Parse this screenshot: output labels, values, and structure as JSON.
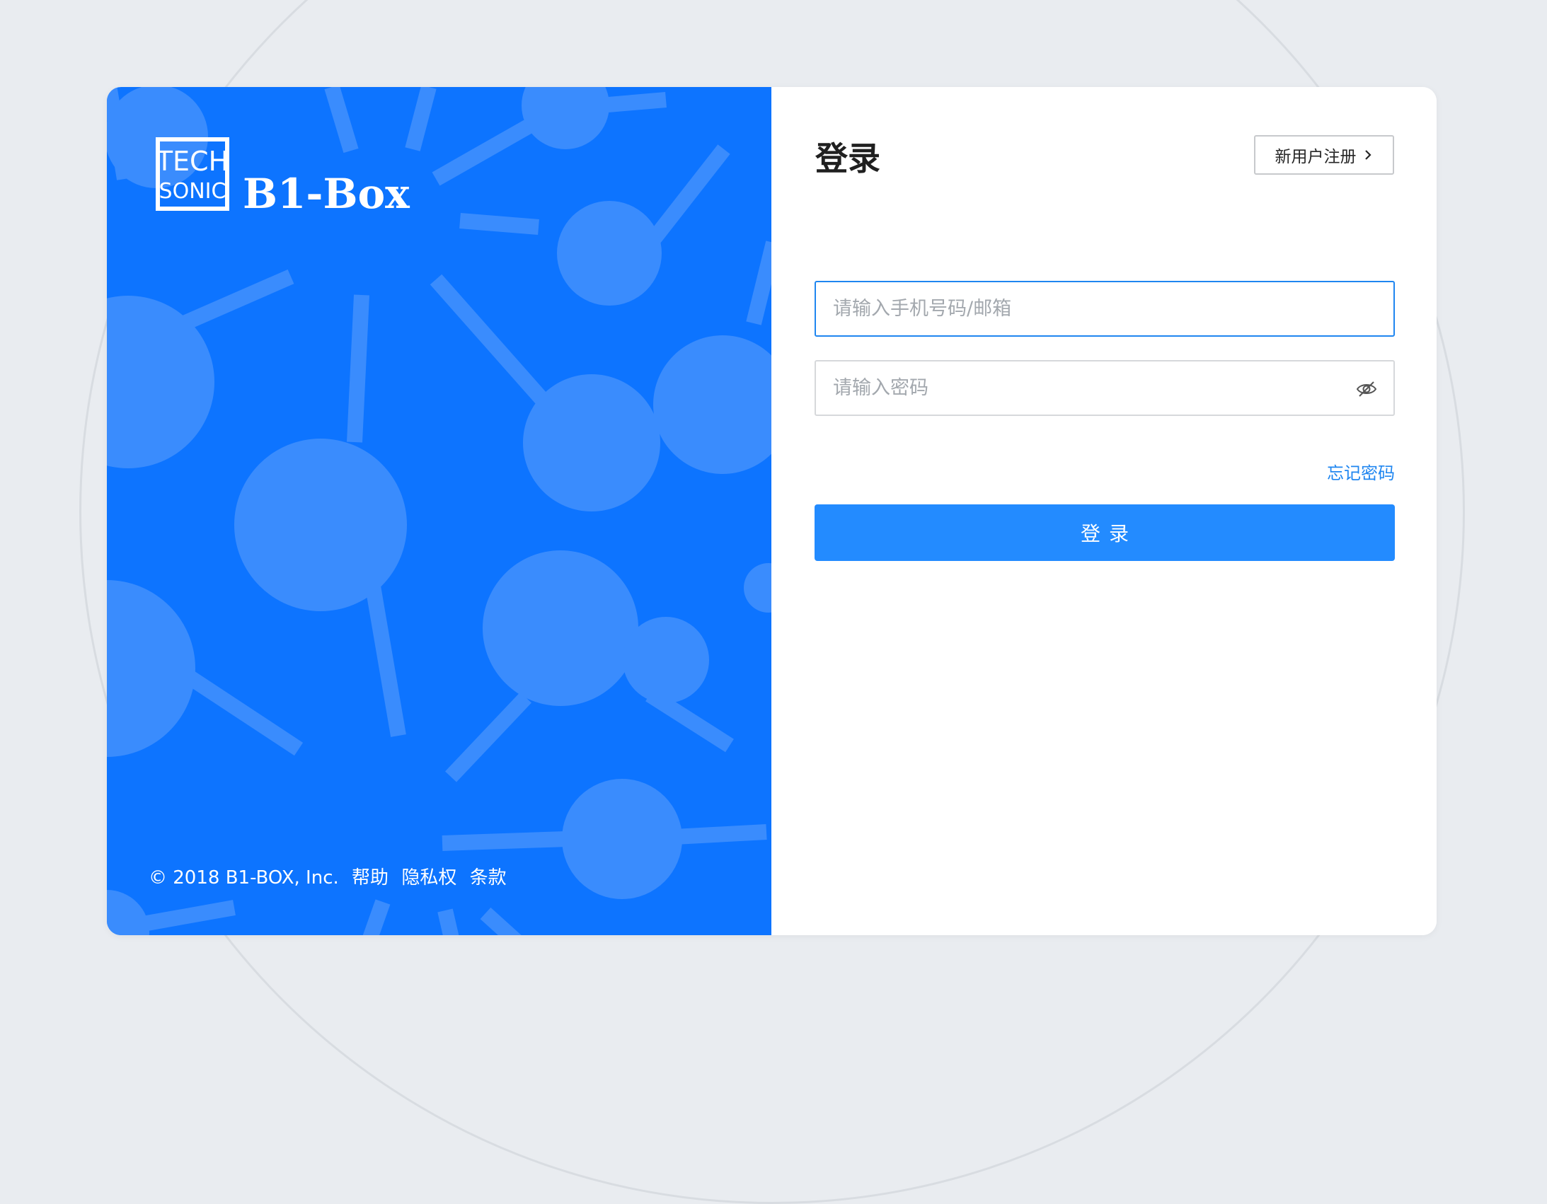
{
  "brand": {
    "logo_line1": "TECH",
    "logo_line2": "SONIC",
    "product_name": "B1-Box"
  },
  "footer": {
    "copyright": "© 2018 B1-BOX, Inc.",
    "links": [
      {
        "label": "帮助"
      },
      {
        "label": "隐私权"
      },
      {
        "label": "条款"
      }
    ]
  },
  "login": {
    "title": "登录",
    "register_label": "新用户注册",
    "account_placeholder": "请输入手机号码/邮箱",
    "password_placeholder": "请输入密码",
    "forgot_label": "忘记密码",
    "submit_label": "登录"
  },
  "icons": {
    "register_arrow": "chevron-right-icon",
    "password_toggle": "eye-off-icon"
  },
  "colors": {
    "brand_blue": "#0d74ff",
    "accent": "#1f86f0",
    "button": "#238bff",
    "page_bg": "#e9ecf0"
  }
}
